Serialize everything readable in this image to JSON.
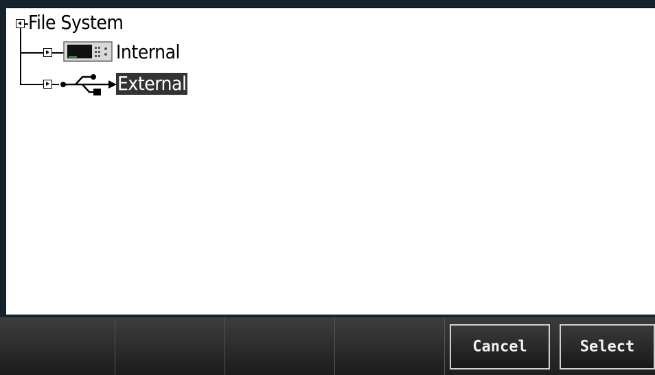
{
  "tree": {
    "root": {
      "label": "File System",
      "expanded": true
    },
    "children": [
      {
        "label": "Internal",
        "icon": "instrument-icon",
        "expanded": false,
        "selected": false
      },
      {
        "label": "External",
        "icon": "usb-icon",
        "expanded": false,
        "selected": true
      }
    ]
  },
  "softkeys": [
    {
      "label": ""
    },
    {
      "label": ""
    },
    {
      "label": ""
    },
    {
      "label": ""
    },
    {
      "label": "Cancel"
    },
    {
      "label": "Select"
    }
  ],
  "colors": {
    "frame": "#16232c",
    "panel": "#ffffff",
    "selection": "#333333",
    "softkey_text": "#f2f2f2"
  }
}
